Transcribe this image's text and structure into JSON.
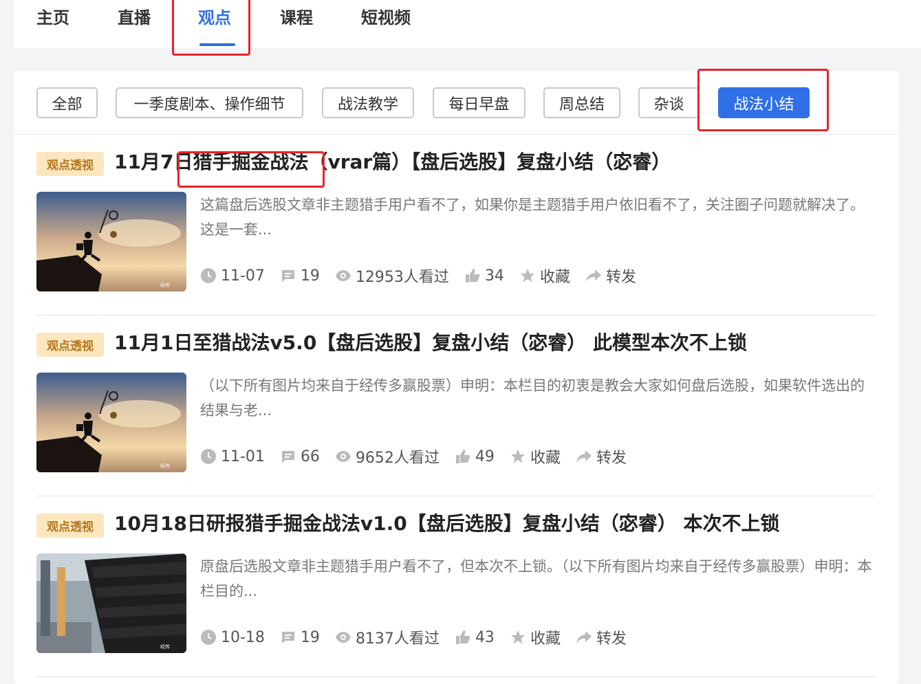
{
  "nav": {
    "tabs": [
      {
        "label": "主页"
      },
      {
        "label": "直播"
      },
      {
        "label": "观点"
      },
      {
        "label": "课程"
      },
      {
        "label": "短视频"
      }
    ],
    "active_index": 2
  },
  "filters": {
    "items": [
      {
        "label": "全部"
      },
      {
        "label": "一季度剧本、操作细节"
      },
      {
        "label": "战法教学"
      },
      {
        "label": "每日早盘"
      },
      {
        "label": "周总结"
      },
      {
        "label": "杂谈"
      },
      {
        "label": "战法小结"
      }
    ],
    "active_index": 6
  },
  "articles": [
    {
      "badge": "观点透视",
      "title": "11月7日猎手掘金战法（vrar篇）【盘后选股】复盘小结（宓睿）",
      "summary": "这篇盘后选股文章非主题猎手用户看不了，如果你是主题猎手用户依旧看不了，关注圈子问题就解决了。这是一套...",
      "date": "11-07",
      "comments": "19",
      "views": "12953人看过",
      "likes": "34",
      "favorite": "收藏",
      "share": "转发",
      "thumb_icon": "runner-sunset-image"
    },
    {
      "badge": "观点透视",
      "title": "11月1日至猎战法v5.0【盘后选股】复盘小结（宓睿） 此模型本次不上锁",
      "summary": "（以下所有图片均来自于经传多赢股票）申明：本栏目的初衷是教会大家如何盘后选股，如果软件选出的结果与老...",
      "date": "11-01",
      "comments": "66",
      "views": "9652人看过",
      "likes": "49",
      "favorite": "收藏",
      "share": "转发",
      "thumb_icon": "runner-sunset-image"
    },
    {
      "badge": "观点透视",
      "title": "10月18日研报猎手掘金战法v1.0【盘后选股】复盘小结（宓睿） 本次不上锁",
      "summary": "原盘后选股文章非主题猎手用户看不了，但本次不上锁。（以下所有图片均来自于经传多赢股票）申明：本栏目的...",
      "date": "10-18",
      "comments": "19",
      "views": "8137人看过",
      "likes": "43",
      "favorite": "收藏",
      "share": "转发",
      "thumb_icon": "warehouse-rubber-image"
    }
  ],
  "colors": {
    "accent": "#2f6fe8",
    "highlight": "#e8232a",
    "badge_bg": "#fbe6bd",
    "badge_text": "#b5761d"
  }
}
